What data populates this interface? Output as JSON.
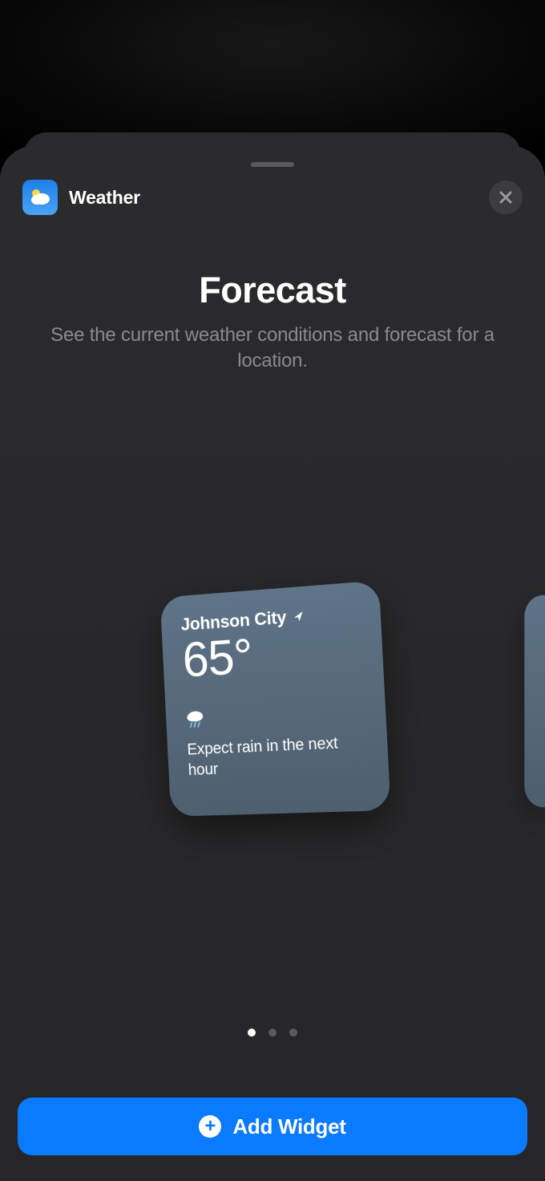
{
  "app": {
    "name": "Weather",
    "icon": "weather-icon"
  },
  "page": {
    "title": "Forecast",
    "subtitle": "See the current weather conditions and forecast for a location."
  },
  "widget_preview": {
    "location": "Johnson City",
    "temperature": "65°",
    "condition_icon": "cloud-rain-icon",
    "description": "Expect rain in the next hour"
  },
  "pagination": {
    "count": 3,
    "active_index": 0
  },
  "action": {
    "label": "Add Widget"
  }
}
